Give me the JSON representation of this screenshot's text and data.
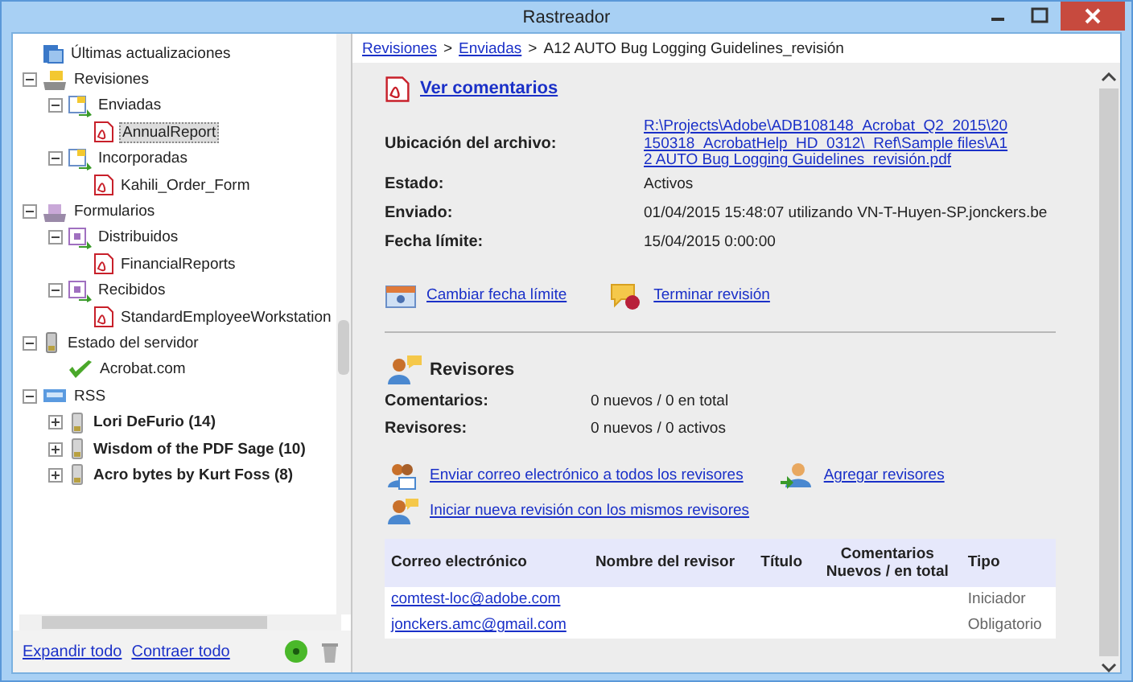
{
  "window": {
    "title": "Rastreador"
  },
  "tree": [
    {
      "label": "Últimas actualizaciones",
      "kind": "updates",
      "bold": false,
      "selected": false
    },
    {
      "label": "Revisiones",
      "kind": "reviews",
      "bold": false,
      "selected": false,
      "expanded": true,
      "children": [
        {
          "label": "Enviadas",
          "kind": "sent",
          "bold": false,
          "selected": false,
          "expanded": true,
          "children": [
            {
              "label": "AnnualReport",
              "kind": "pdf",
              "bold": false,
              "selected": true
            }
          ]
        },
        {
          "label": "Incorporadas",
          "kind": "sent",
          "bold": false,
          "selected": false,
          "expanded": true,
          "children": [
            {
              "label": "Kahili_Order_Form",
              "kind": "pdf",
              "bold": false,
              "selected": false
            }
          ]
        }
      ]
    },
    {
      "label": "Formularios",
      "kind": "forms",
      "bold": false,
      "selected": false,
      "expanded": true,
      "children": [
        {
          "label": "Distribuidos",
          "kind": "form",
          "bold": false,
          "selected": false,
          "expanded": true,
          "children": [
            {
              "label": "FinancialReports",
              "kind": "pdf",
              "bold": false,
              "selected": false
            }
          ]
        },
        {
          "label": "Recibidos",
          "kind": "form",
          "bold": false,
          "selected": false,
          "expanded": true,
          "children": [
            {
              "label": "StandardEmployeeWorkstation",
              "kind": "pdf",
              "bold": false,
              "selected": false
            }
          ]
        }
      ]
    },
    {
      "label": "Estado del servidor",
      "kind": "server",
      "bold": false,
      "selected": false,
      "expanded": true,
      "children": [
        {
          "label": "Acrobat.com",
          "kind": "check",
          "bold": false,
          "selected": false
        }
      ]
    },
    {
      "label": "RSS",
      "kind": "rss",
      "bold": false,
      "selected": false,
      "expanded": true,
      "children": [
        {
          "label": "Lori DeFurio (14)",
          "kind": "feed",
          "bold": true,
          "selected": false,
          "expanded": false
        },
        {
          "label": "Wisdom of the PDF Sage (10)",
          "kind": "feed",
          "bold": true,
          "selected": false,
          "expanded": false
        },
        {
          "label": "Acro bytes by Kurt Foss (8)",
          "kind": "feed",
          "bold": true,
          "selected": false,
          "expanded": false
        }
      ]
    }
  ],
  "sidebar_footer": {
    "links": [
      "Expandir todo",
      "Contraer todo"
    ]
  },
  "breadcrumb": {
    "separator": ">",
    "items": [
      {
        "label": "Revisiones",
        "link": true
      },
      {
        "label": "Enviadas",
        "link": true
      },
      {
        "label": "A12 AUTO Bug Logging Guidelines_revisión",
        "link": false
      }
    ]
  },
  "view_comments": "Ver comentarios",
  "fields": [
    {
      "label": "Ubicación del archivo:",
      "value": "R:\\Projects\\Adobe\\ADB108148_Acrobat_Q2_2015\\20150318_AcrobatHelp_HD_0312\\_Ref\\Sample files\\A12 AUTO Bug Logging Guidelines_revisión.pdf",
      "kind": "link"
    },
    {
      "label": "Estado:",
      "value": "Activos",
      "kind": "text"
    },
    {
      "label": "Enviado:",
      "value": "01/04/2015 15:48:07 utilizando VN-T-Huyen-SP.jonckers.be",
      "kind": "text"
    },
    {
      "label": "Fecha límite:",
      "value": "15/04/2015 0:00:00",
      "kind": "text"
    }
  ],
  "review_actions": [
    {
      "label": "Cambiar fecha límite",
      "kind": "calendar"
    },
    {
      "label": "Terminar revisión",
      "kind": "stop"
    }
  ],
  "reviewers": {
    "title": "Revisores",
    "stats": [
      {
        "label": "Comentarios:",
        "value": "0 nuevos / 0 en total"
      },
      {
        "label": "Revisores:",
        "value": "0 nuevos / 0 activos"
      }
    ],
    "actions": [
      {
        "label": "Enviar correo electrónico a todos los revisores",
        "kind": "mail-people"
      },
      {
        "label": "Agregar revisores",
        "kind": "add-person"
      },
      {
        "label": "Iniciar nueva revisión con los mismos revisores",
        "kind": "people"
      }
    ],
    "table": {
      "columns": [
        "Correo electrónico",
        "Nombre del revisor",
        "Título",
        "Comentarios Nuevos / en total",
        "Tipo"
      ],
      "rows": [
        {
          "email": "comtest-loc@adobe.com",
          "type": "Iniciador"
        },
        {
          "email": "jonckers.amc@gmail.com",
          "type": "Obligatorio"
        }
      ]
    }
  }
}
